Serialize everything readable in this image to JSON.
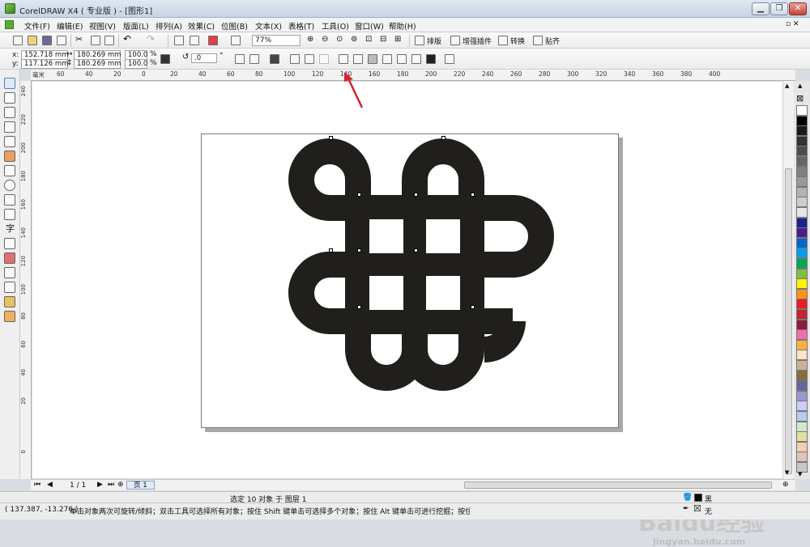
{
  "window": {
    "title": "CorelDRAW X4 ( 专业版 ) - [图形1]",
    "minimize": "▁",
    "maximize": "❐",
    "close": "✕"
  },
  "menus": [
    "文件(F)",
    "编辑(E)",
    "视图(V)",
    "版面(L)",
    "排列(A)",
    "效果(C)",
    "位图(B)",
    "文本(X)",
    "表格(T)",
    "工具(O)",
    "窗口(W)",
    "帮助(H)"
  ],
  "standard_toolbar": {
    "zoom_value": "77%",
    "plugin_buttons": [
      "排版",
      "增强插件",
      "转换",
      "贴齐"
    ]
  },
  "property_bar": {
    "x_label": "x:",
    "x_value": "152.718 mm",
    "y_label": "y:",
    "y_value": "117.126 mm",
    "width_value": "180.269 mm",
    "height_value": "180.269 mm",
    "scale_w": "100.0",
    "scale_h": "100.0",
    "percent": "%",
    "rotation": ".0",
    "degree": "°"
  },
  "ruler": {
    "h_ticks": [
      "60",
      "40",
      "20",
      "0",
      "20",
      "40",
      "60",
      "80",
      "100",
      "120",
      "140",
      "160",
      "180",
      "200",
      "220",
      "240",
      "260",
      "280",
      "300",
      "320",
      "340",
      "360",
      "380",
      "400"
    ],
    "v_ticks": [
      "240",
      "220",
      "200",
      "180",
      "160",
      "140",
      "120",
      "100",
      "80",
      "60",
      "40",
      "20",
      "0"
    ],
    "unit": "毫米"
  },
  "page_nav": {
    "counter": "1 / 1",
    "tab": "页 1"
  },
  "status": {
    "selection": "选定 10 对象 于 图层 1",
    "coords": "( 137.387, -13.276 )",
    "hint": "单击对象两次可旋转/倾斜；双击工具可选择所有对象；按住 Shift 键单击可选择多个对象；按住 Alt 键单击可进行挖掘；按住 Ctrl 并单...",
    "fill_label": "黑",
    "outline_label": "无"
  },
  "watermark": {
    "brand": "Baidu经验",
    "url": "jingyan.baidu.com"
  },
  "palette": [
    "#ffffff",
    "#000000",
    "#1a1a1a",
    "#333333",
    "#4d4d4d",
    "#666666",
    "#808080",
    "#999999",
    "#b3b3b3",
    "#cccccc",
    "#e5e5e5",
    "#1e1f8c",
    "#4b1e8c",
    "#0066cc",
    "#00a0e9",
    "#00a650",
    "#7ac142",
    "#fff200",
    "#f7941d",
    "#ed1c24",
    "#c1272d",
    "#8c1d40",
    "#f06eaa",
    "#fbb040",
    "#ffe4c4",
    "#c7b299",
    "#8b6b3d",
    "#666699",
    "#9999cc",
    "#ccccff",
    "#b0d0e8",
    "#d0e8d0",
    "#e0e0a0",
    "#f0d0b0",
    "#e0c0c0",
    "#c8c8c8"
  ]
}
